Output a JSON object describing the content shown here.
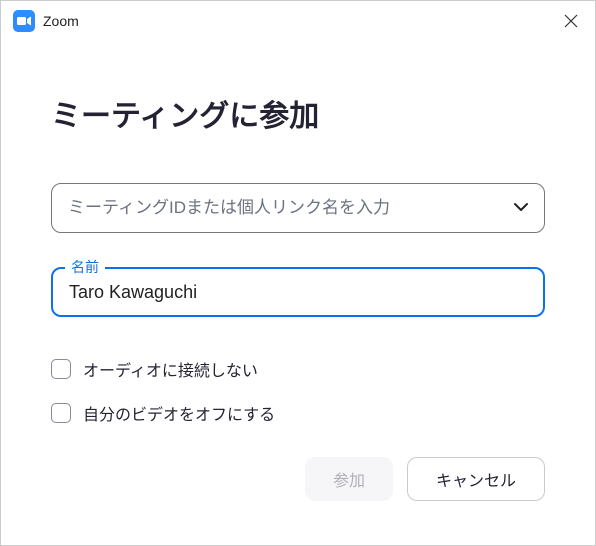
{
  "titlebar": {
    "title": "Zoom"
  },
  "heading": "ミーティングに参加",
  "meetingId": {
    "placeholder": "ミーティングIDまたは個人リンク名を入力",
    "value": ""
  },
  "name": {
    "label": "名前",
    "value": "Taro Kawaguchi"
  },
  "options": {
    "noAudio": "オーディオに接続しない",
    "noVideo": "自分のビデオをオフにする"
  },
  "buttons": {
    "join": "参加",
    "cancel": "キャンセル"
  }
}
